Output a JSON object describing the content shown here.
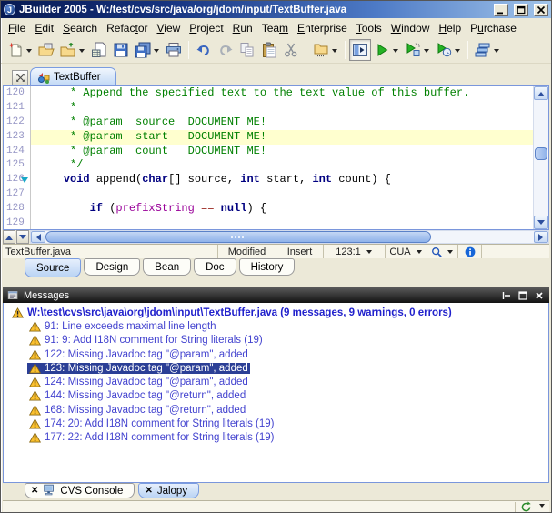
{
  "window": {
    "title": "JBuilder 2005 - W:/test/cvs/src/java/org/jdom/input/TextBuffer.java",
    "logo_letter": "J"
  },
  "menu": {
    "items": [
      {
        "label": "File",
        "mnemonic_index": 0
      },
      {
        "label": "Edit",
        "mnemonic_index": 0
      },
      {
        "label": "Search",
        "mnemonic_index": 0
      },
      {
        "label": "Refactor",
        "mnemonic_index": 5
      },
      {
        "label": "View",
        "mnemonic_index": 0
      },
      {
        "label": "Project",
        "mnemonic_index": 0
      },
      {
        "label": "Run",
        "mnemonic_index": 0
      },
      {
        "label": "Team",
        "mnemonic_index": 3
      },
      {
        "label": "Enterprise",
        "mnemonic_index": 0
      },
      {
        "label": "Tools",
        "mnemonic_index": 0
      },
      {
        "label": "Window",
        "mnemonic_index": 0
      },
      {
        "label": "Help",
        "mnemonic_index": 0
      },
      {
        "label": "Purchase",
        "mnemonic_index": 1
      }
    ]
  },
  "toolbar": {
    "groups": [
      [
        {
          "icon": "new-file",
          "dropdown": true
        },
        {
          "icon": "open-file"
        },
        {
          "icon": "open-project",
          "dropdown": true
        },
        {
          "icon": "save-as"
        },
        {
          "icon": "save"
        },
        {
          "icon": "save-all",
          "dropdown": true
        },
        {
          "icon": "print"
        }
      ],
      [
        {
          "icon": "undo"
        },
        {
          "icon": "redo"
        },
        {
          "icon": "copy"
        },
        {
          "icon": "paste"
        },
        {
          "icon": "cut"
        }
      ],
      [
        {
          "icon": "browse-classes",
          "dropdown": true
        }
      ],
      [
        {
          "icon": "toggle-panel",
          "pressed": true
        },
        {
          "icon": "run",
          "dropdown": true
        },
        {
          "icon": "debug",
          "dropdown": true
        },
        {
          "icon": "profile",
          "dropdown": true
        }
      ],
      [
        {
          "icon": "window-list",
          "dropdown": true
        }
      ]
    ]
  },
  "editor": {
    "tab_label": "TextBuffer",
    "lines": [
      {
        "no": "120",
        "segs": [
          [
            "c",
            "     * Append the specified text to the text value of this buffer."
          ]
        ]
      },
      {
        "no": "121",
        "segs": [
          [
            "c",
            "     *"
          ]
        ]
      },
      {
        "no": "122",
        "segs": [
          [
            "c",
            "     * @param  source  DOCUMENT ME!"
          ]
        ]
      },
      {
        "no": "123",
        "highlighted": true,
        "segs": [
          [
            "c",
            "     * @param  start   DOCUMENT ME!"
          ]
        ]
      },
      {
        "no": "124",
        "segs": [
          [
            "c",
            "     * @param  count   DOCUMENT ME!"
          ]
        ]
      },
      {
        "no": "125",
        "segs": [
          [
            "c",
            "     */"
          ]
        ]
      },
      {
        "no": "126",
        "fold": true,
        "segs": [
          [
            "p",
            "    "
          ],
          [
            "k",
            "void"
          ],
          [
            "p",
            " append("
          ],
          [
            "k",
            "char"
          ],
          [
            "p",
            "[] source, "
          ],
          [
            "k",
            "int"
          ],
          [
            "p",
            " start, "
          ],
          [
            "k",
            "int"
          ],
          [
            "p",
            " count) {"
          ]
        ]
      },
      {
        "no": "127",
        "segs": []
      },
      {
        "no": "128",
        "segs": [
          [
            "p",
            "        "
          ],
          [
            "k",
            "if"
          ],
          [
            "p",
            " ("
          ],
          [
            "f",
            "prefixString"
          ],
          [
            "p",
            " "
          ],
          [
            "o",
            "=="
          ],
          [
            "p",
            " "
          ],
          [
            "k",
            "null"
          ],
          [
            "p",
            ") {"
          ]
        ]
      },
      {
        "no": "129",
        "segs": []
      }
    ]
  },
  "status_bar": {
    "filename": "TextBuffer.java",
    "modified": "Modified",
    "mode": "Insert",
    "caret": "123:1",
    "keymap": "CUA"
  },
  "view_tabs": [
    {
      "label": "Source",
      "active": true
    },
    {
      "label": "Design",
      "active": false
    },
    {
      "label": "Bean",
      "active": false
    },
    {
      "label": "Doc",
      "active": false
    },
    {
      "label": "History",
      "active": false
    }
  ],
  "messages": {
    "title": "Messages",
    "root": "W:\\test\\cvs\\src\\java\\org\\jdom\\input\\TextBuffer.java (9 messages, 9 warnings, 0 errors)",
    "items": [
      {
        "text": "91: Line exceeds maximal line length",
        "selected": false
      },
      {
        "text": "91: 9: Add I18N comment for String literals (19)",
        "selected": false
      },
      {
        "text": "122: Missing Javadoc tag \"@param\", added",
        "selected": false
      },
      {
        "text": "123: Missing Javadoc tag \"@param\", added",
        "selected": true
      },
      {
        "text": "124: Missing Javadoc tag \"@param\", added",
        "selected": false
      },
      {
        "text": "144: Missing Javadoc tag \"@return\", added",
        "selected": false
      },
      {
        "text": "168: Missing Javadoc tag \"@return\", added",
        "selected": false
      },
      {
        "text": "174: 20: Add I18N comment for String literals (19)",
        "selected": false
      },
      {
        "text": "177: 22: Add I18N comment for String literals (19)",
        "selected": false
      }
    ]
  },
  "bottom_tabs": [
    {
      "label": "CVS Console",
      "icon": "console",
      "active": false,
      "close_glyph": "✕"
    },
    {
      "label": "Jalopy",
      "icon": null,
      "active": true,
      "close_glyph": "✕"
    }
  ],
  "colors": {
    "title_gradient_start": "#071a52",
    "title_gradient_end": "#a2c5ea",
    "comment": "#008000",
    "keyword": "#000080",
    "field": "#990099",
    "operator": "#99261f",
    "highlight_line": "#ffffcf",
    "message_text": "#4343cf",
    "message_root": "#2121cc",
    "selection_bg": "#2b3f96",
    "warning_icon": "#fbc02d",
    "tab_active_bg": "#bad4f4"
  }
}
